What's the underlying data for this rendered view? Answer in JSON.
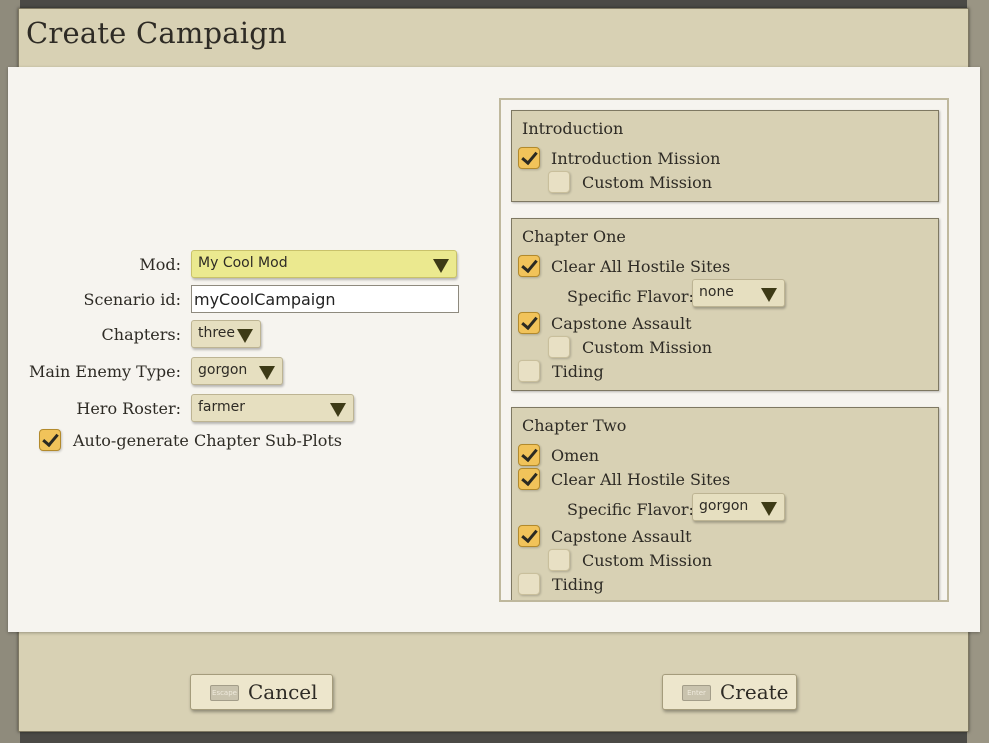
{
  "dialog": {
    "title": "Create Campaign"
  },
  "form": {
    "mod": {
      "label": "Mod:",
      "value": "My Cool Mod"
    },
    "scenario_id": {
      "label": "Scenario id:",
      "value": "myCoolCampaign"
    },
    "chapters": {
      "label": "Chapters:",
      "value": "three"
    },
    "main_enemy": {
      "label": "Main Enemy Type:",
      "value": "gorgon"
    },
    "hero_roster": {
      "label": "Hero Roster:",
      "value": "farmer"
    },
    "auto_generate": {
      "label": "Auto-generate Chapter Sub-Plots",
      "checked": true
    }
  },
  "chapters": [
    {
      "title": "Introduction",
      "introduction_mission": {
        "label": "Introduction Mission",
        "checked": true
      },
      "custom_mission": {
        "label": "Custom Mission",
        "checked": false
      }
    },
    {
      "title": "Chapter One",
      "clear_sites": {
        "label": "Clear All Hostile Sites",
        "checked": true
      },
      "flavor": {
        "label": "Specific Flavor:",
        "value": "none"
      },
      "capstone": {
        "label": "Capstone Assault",
        "checked": true
      },
      "custom_mission": {
        "label": "Custom Mission",
        "checked": false
      },
      "tiding": {
        "label": "Tiding",
        "checked": false
      }
    },
    {
      "title": "Chapter Two",
      "omen": {
        "label": "Omen",
        "checked": true
      },
      "clear_sites": {
        "label": "Clear All Hostile Sites",
        "checked": true
      },
      "flavor": {
        "label": "Specific Flavor:",
        "value": "gorgon"
      },
      "capstone": {
        "label": "Capstone Assault",
        "checked": true
      },
      "custom_mission": {
        "label": "Custom Mission",
        "checked": false
      },
      "tiding": {
        "label": "Tiding",
        "checked": false
      }
    }
  ],
  "buttons": {
    "cancel": {
      "label": "Cancel",
      "key": "Escape"
    },
    "create": {
      "label": "Create",
      "key": "Enter"
    }
  },
  "colors": {
    "panel_bg": "#f6f4ef",
    "frame_bg": "#d8d1b4",
    "checkbox_checked": "#f1c35a",
    "dropdown_highlight": "#ebe98f"
  }
}
